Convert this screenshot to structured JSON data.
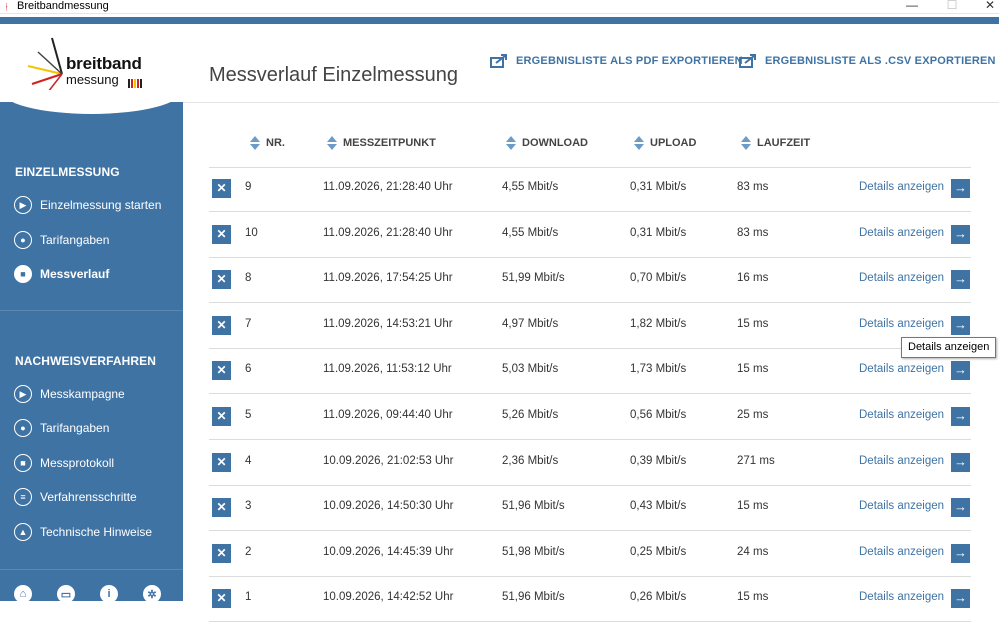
{
  "window": {
    "title": "Breitbandmessung",
    "minimize": "—",
    "maximize": "☐",
    "close": "✕"
  },
  "logo": {
    "word1": "breitband",
    "word2": "messung"
  },
  "sidebar": {
    "section1_title": "EINZELMESSUNG",
    "section1_items": [
      {
        "label": "Einzelmessung starten",
        "icon": "play-icon"
      },
      {
        "label": "Tarifangaben",
        "icon": "person-icon"
      },
      {
        "label": "Messverlauf",
        "icon": "clipboard-icon",
        "active": true
      }
    ],
    "section2_title": "NACHWEISVERFAHREN",
    "section2_items": [
      {
        "label": "Messkampagne",
        "icon": "play-icon"
      },
      {
        "label": "Tarifangaben",
        "icon": "person-icon"
      },
      {
        "label": "Messprotokoll",
        "icon": "clipboard-icon"
      },
      {
        "label": "Verfahrensschritte",
        "icon": "list-icon"
      },
      {
        "label": "Technische Hinweise",
        "icon": "warning-icon"
      }
    ],
    "bottom_icons": [
      "home-icon",
      "chat-icon",
      "info-icon",
      "gear-icon"
    ]
  },
  "main": {
    "title": "Messverlauf Einzelmessung",
    "export_pdf": "ERGEBNISLISTE ALS PDF EXPORTIEREN",
    "export_csv": "ERGEBNISLISTE ALS .CSV EXPORTIEREN",
    "columns": {
      "nr": "NR.",
      "time": "MESSZEITPUNKT",
      "download": "DOWNLOAD",
      "upload": "UPLOAD",
      "latency": "LAUFZEIT"
    },
    "rows": [
      {
        "nr": "9",
        "time": "11.09.2026, 21:28:40 Uhr",
        "download": "4,55 Mbit/s",
        "upload": "0,31 Mbit/s",
        "latency": "83 ms",
        "details": "Details anzeigen"
      },
      {
        "nr": "10",
        "time": "11.09.2026, 21:28:40 Uhr",
        "download": "4,55 Mbit/s",
        "upload": "0,31 Mbit/s",
        "latency": "83 ms",
        "details": "Details anzeigen"
      },
      {
        "nr": "8",
        "time": "11.09.2026, 17:54:25 Uhr",
        "download": "51,99 Mbit/s",
        "upload": "0,70 Mbit/s",
        "latency": "16 ms",
        "details": "Details anzeigen"
      },
      {
        "nr": "7",
        "time": "11.09.2026, 14:53:21 Uhr",
        "download": "4,97 Mbit/s",
        "upload": "1,82 Mbit/s",
        "latency": "15 ms",
        "details": "Details anzeigen"
      },
      {
        "nr": "6",
        "time": "11.09.2026, 11:53:12 Uhr",
        "download": "5,03 Mbit/s",
        "upload": "1,73 Mbit/s",
        "latency": "15 ms",
        "details": "Details anzeigen"
      },
      {
        "nr": "5",
        "time": "11.09.2026, 09:44:40 Uhr",
        "download": "5,26 Mbit/s",
        "upload": "0,56 Mbit/s",
        "latency": "25 ms",
        "details": "Details anzeigen"
      },
      {
        "nr": "4",
        "time": "10.09.2026, 21:02:53 Uhr",
        "download": "2,36 Mbit/s",
        "upload": "0,39 Mbit/s",
        "latency": "271 ms",
        "details": "Details anzeigen"
      },
      {
        "nr": "3",
        "time": "10.09.2026, 14:50:30 Uhr",
        "download": "51,96 Mbit/s",
        "upload": "0,43 Mbit/s",
        "latency": "15 ms",
        "details": "Details anzeigen"
      },
      {
        "nr": "2",
        "time": "10.09.2026, 14:45:39 Uhr",
        "download": "51,98 Mbit/s",
        "upload": "0,25 Mbit/s",
        "latency": "24 ms",
        "details": "Details anzeigen"
      },
      {
        "nr": "1",
        "time": "10.09.2026, 14:42:52 Uhr",
        "download": "51,96 Mbit/s",
        "upload": "0,26 Mbit/s",
        "latency": "15 ms",
        "details": "Details anzeigen"
      }
    ],
    "delete_glyph": "✕",
    "go_glyph": "→",
    "tooltip": "Details anzeigen"
  },
  "colors": {
    "accent": "#3f73a4",
    "sort_arrow": "#6e9bc6"
  }
}
